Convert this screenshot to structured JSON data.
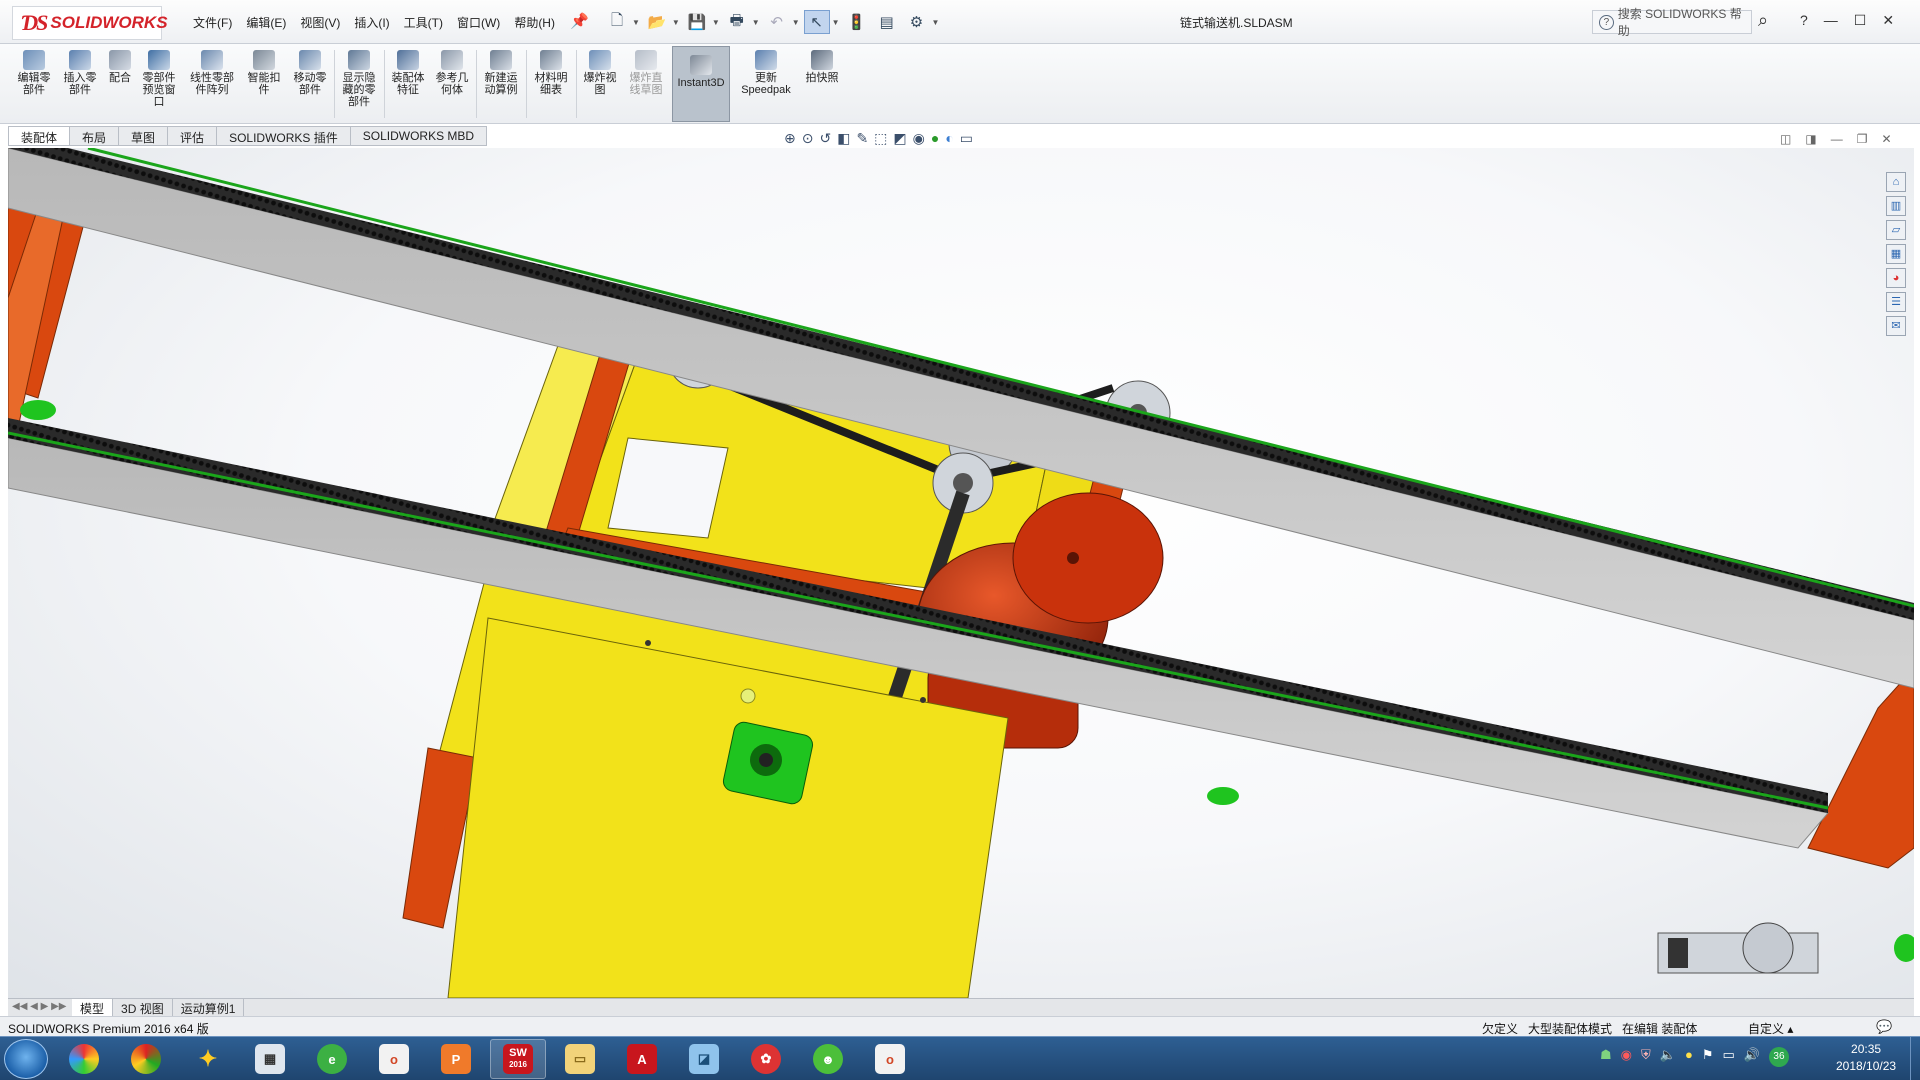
{
  "app": {
    "logo_text": "SOLIDWORKS",
    "document_title": "链式输送机.SLDASM",
    "help_search_placeholder": "搜索 SOLIDWORKS 帮助",
    "help_symbol": "?"
  },
  "menu": [
    "文件(F)",
    "编辑(E)",
    "视图(V)",
    "插入(I)",
    "工具(T)",
    "窗口(W)",
    "帮助(H)"
  ],
  "ribbon": {
    "edit_component": "编辑零部件",
    "insert_components": "插入零部件",
    "mate": "配合",
    "component_preview": "零部件预览窗口",
    "linear_pattern": "线性零部件阵列",
    "smart_fasteners": "智能扣件",
    "move_component": "移动零部件",
    "show_hidden": "显示隐藏的零部件",
    "assembly_features": "装配体特征",
    "reference_geometry": "参考几何体",
    "new_motion_study": "新建运动算例",
    "bom": "材料明细表",
    "exploded_view": "爆炸视图",
    "explode_line": "爆炸直线草图",
    "instant3d": "Instant3D",
    "update_speedpak": "更新Speedpak",
    "snapshot": "拍快照"
  },
  "tabs": [
    "装配体",
    "布局",
    "草图",
    "评估",
    "SOLIDWORKS 插件",
    "SOLIDWORKS MBD"
  ],
  "bottom_tabs": [
    "模型",
    "3D 视图",
    "运动算例1"
  ],
  "status": {
    "product": "SOLIDWORKS Premium 2016 x64 版",
    "under_defined": "欠定义",
    "large_assembly": "大型装配体模式",
    "editing": "在编辑 装配体",
    "custom": "自定义"
  },
  "taskbar": {
    "sw_label": "2016",
    "tray_badge": "36",
    "time": "20:35",
    "date": "2018/10/23"
  },
  "colors": {
    "frame_orange": "#d9480f",
    "panel_yellow": "#f2e21a",
    "rail_gray": "#c9c9c9",
    "chain_black": "#1d1d1d",
    "motor_red": "#c9320c",
    "bearing_green": "#1fc41f",
    "accent_blue": "#2b66b1"
  },
  "icons": {
    "window_controls": [
      "minimize-icon",
      "maximize-icon",
      "close-icon"
    ],
    "task_pane": [
      "home-icon",
      "design-library-icon",
      "file-explorer-icon",
      "view-palette-icon",
      "appearances-icon",
      "custom-properties-icon",
      "forum-icon"
    ]
  }
}
